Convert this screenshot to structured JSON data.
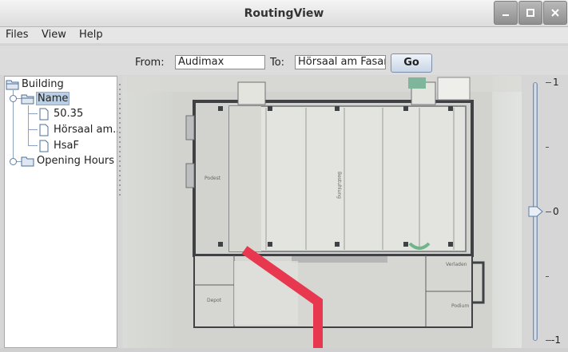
{
  "window": {
    "title": "RoutingView"
  },
  "window_buttons": [
    "minimize-icon",
    "maximize-icon",
    "close-icon"
  ],
  "menu": {
    "files": "Files",
    "view": "View",
    "help": "Help"
  },
  "toolbar": {
    "from_label": "From:",
    "from_value": "Audimax",
    "to_label": "To:",
    "to_value": "Hörsaal am Fasan",
    "go_label": "Go"
  },
  "tree": {
    "root": "Building",
    "name_node": "Name",
    "leaves": [
      "50.35",
      "Hörsaal am...",
      "HsaF"
    ],
    "opening_hours": "Opening Hours"
  },
  "slider": {
    "max_label": "1",
    "mid_label": "0",
    "min_label": "-1",
    "value": 0
  },
  "colors": {
    "route": "#e8384f",
    "selection": "#b8cfe5",
    "accent": "#7d8fa8"
  }
}
